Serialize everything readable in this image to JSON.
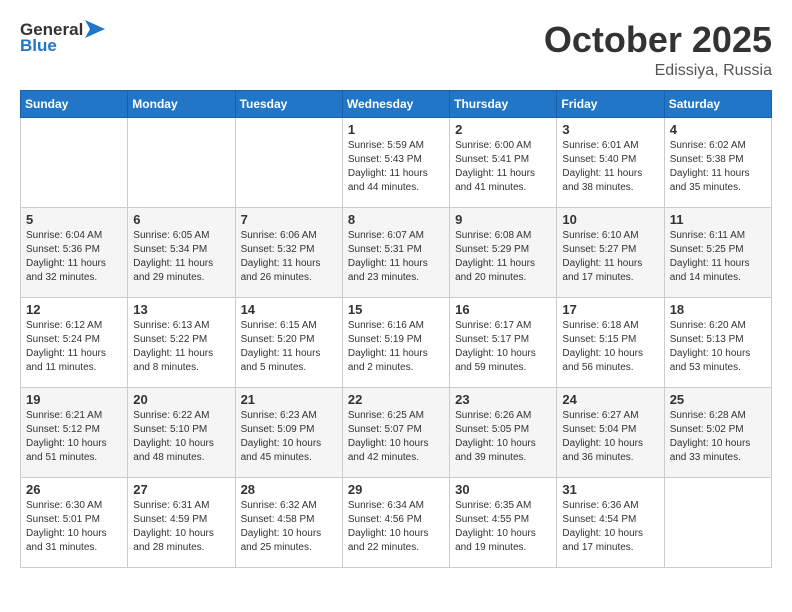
{
  "header": {
    "logo_general": "General",
    "logo_blue": "Blue",
    "month": "October 2025",
    "location": "Edissiya, Russia"
  },
  "weekdays": [
    "Sunday",
    "Monday",
    "Tuesday",
    "Wednesday",
    "Thursday",
    "Friday",
    "Saturday"
  ],
  "weeks": [
    [
      {
        "day": "",
        "info": ""
      },
      {
        "day": "",
        "info": ""
      },
      {
        "day": "",
        "info": ""
      },
      {
        "day": "1",
        "info": "Sunrise: 5:59 AM\nSunset: 5:43 PM\nDaylight: 11 hours\nand 44 minutes."
      },
      {
        "day": "2",
        "info": "Sunrise: 6:00 AM\nSunset: 5:41 PM\nDaylight: 11 hours\nand 41 minutes."
      },
      {
        "day": "3",
        "info": "Sunrise: 6:01 AM\nSunset: 5:40 PM\nDaylight: 11 hours\nand 38 minutes."
      },
      {
        "day": "4",
        "info": "Sunrise: 6:02 AM\nSunset: 5:38 PM\nDaylight: 11 hours\nand 35 minutes."
      }
    ],
    [
      {
        "day": "5",
        "info": "Sunrise: 6:04 AM\nSunset: 5:36 PM\nDaylight: 11 hours\nand 32 minutes."
      },
      {
        "day": "6",
        "info": "Sunrise: 6:05 AM\nSunset: 5:34 PM\nDaylight: 11 hours\nand 29 minutes."
      },
      {
        "day": "7",
        "info": "Sunrise: 6:06 AM\nSunset: 5:32 PM\nDaylight: 11 hours\nand 26 minutes."
      },
      {
        "day": "8",
        "info": "Sunrise: 6:07 AM\nSunset: 5:31 PM\nDaylight: 11 hours\nand 23 minutes."
      },
      {
        "day": "9",
        "info": "Sunrise: 6:08 AM\nSunset: 5:29 PM\nDaylight: 11 hours\nand 20 minutes."
      },
      {
        "day": "10",
        "info": "Sunrise: 6:10 AM\nSunset: 5:27 PM\nDaylight: 11 hours\nand 17 minutes."
      },
      {
        "day": "11",
        "info": "Sunrise: 6:11 AM\nSunset: 5:25 PM\nDaylight: 11 hours\nand 14 minutes."
      }
    ],
    [
      {
        "day": "12",
        "info": "Sunrise: 6:12 AM\nSunset: 5:24 PM\nDaylight: 11 hours\nand 11 minutes."
      },
      {
        "day": "13",
        "info": "Sunrise: 6:13 AM\nSunset: 5:22 PM\nDaylight: 11 hours\nand 8 minutes."
      },
      {
        "day": "14",
        "info": "Sunrise: 6:15 AM\nSunset: 5:20 PM\nDaylight: 11 hours\nand 5 minutes."
      },
      {
        "day": "15",
        "info": "Sunrise: 6:16 AM\nSunset: 5:19 PM\nDaylight: 11 hours\nand 2 minutes."
      },
      {
        "day": "16",
        "info": "Sunrise: 6:17 AM\nSunset: 5:17 PM\nDaylight: 10 hours\nand 59 minutes."
      },
      {
        "day": "17",
        "info": "Sunrise: 6:18 AM\nSunset: 5:15 PM\nDaylight: 10 hours\nand 56 minutes."
      },
      {
        "day": "18",
        "info": "Sunrise: 6:20 AM\nSunset: 5:13 PM\nDaylight: 10 hours\nand 53 minutes."
      }
    ],
    [
      {
        "day": "19",
        "info": "Sunrise: 6:21 AM\nSunset: 5:12 PM\nDaylight: 10 hours\nand 51 minutes."
      },
      {
        "day": "20",
        "info": "Sunrise: 6:22 AM\nSunset: 5:10 PM\nDaylight: 10 hours\nand 48 minutes."
      },
      {
        "day": "21",
        "info": "Sunrise: 6:23 AM\nSunset: 5:09 PM\nDaylight: 10 hours\nand 45 minutes."
      },
      {
        "day": "22",
        "info": "Sunrise: 6:25 AM\nSunset: 5:07 PM\nDaylight: 10 hours\nand 42 minutes."
      },
      {
        "day": "23",
        "info": "Sunrise: 6:26 AM\nSunset: 5:05 PM\nDaylight: 10 hours\nand 39 minutes."
      },
      {
        "day": "24",
        "info": "Sunrise: 6:27 AM\nSunset: 5:04 PM\nDaylight: 10 hours\nand 36 minutes."
      },
      {
        "day": "25",
        "info": "Sunrise: 6:28 AM\nSunset: 5:02 PM\nDaylight: 10 hours\nand 33 minutes."
      }
    ],
    [
      {
        "day": "26",
        "info": "Sunrise: 6:30 AM\nSunset: 5:01 PM\nDaylight: 10 hours\nand 31 minutes."
      },
      {
        "day": "27",
        "info": "Sunrise: 6:31 AM\nSunset: 4:59 PM\nDaylight: 10 hours\nand 28 minutes."
      },
      {
        "day": "28",
        "info": "Sunrise: 6:32 AM\nSunset: 4:58 PM\nDaylight: 10 hours\nand 25 minutes."
      },
      {
        "day": "29",
        "info": "Sunrise: 6:34 AM\nSunset: 4:56 PM\nDaylight: 10 hours\nand 22 minutes."
      },
      {
        "day": "30",
        "info": "Sunrise: 6:35 AM\nSunset: 4:55 PM\nDaylight: 10 hours\nand 19 minutes."
      },
      {
        "day": "31",
        "info": "Sunrise: 6:36 AM\nSunset: 4:54 PM\nDaylight: 10 hours\nand 17 minutes."
      },
      {
        "day": "",
        "info": ""
      }
    ]
  ]
}
